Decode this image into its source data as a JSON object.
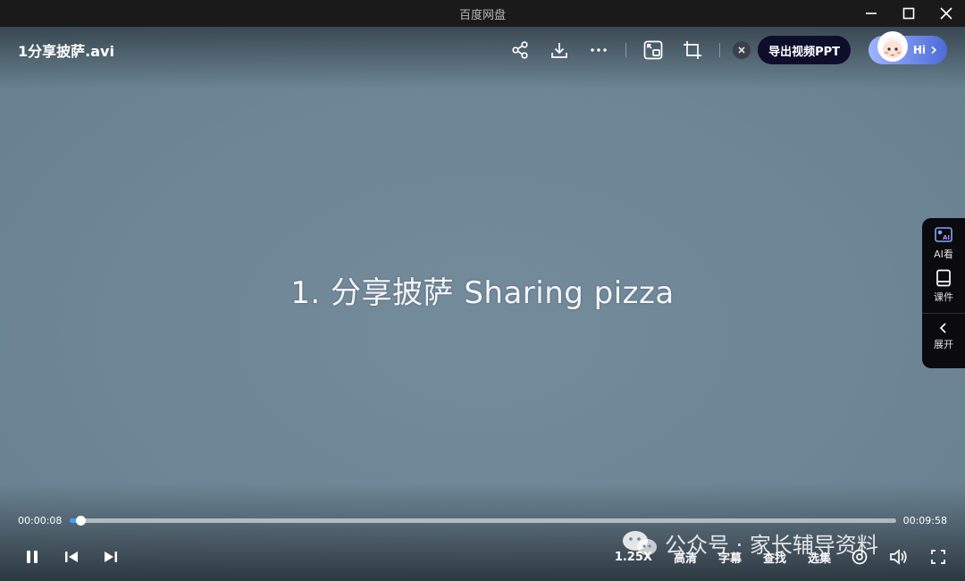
{
  "window": {
    "title": "百度网盘"
  },
  "player": {
    "file_name": "1分享披萨.avi",
    "caption": "1. 分享披萨  Sharing pizza",
    "export_ppt_label": "导出视频PPT",
    "hi_label": "Hi",
    "current_time": "00:00:08",
    "total_time": "00:09:58",
    "progress_fraction": 0.013,
    "accent_color": "#3aa0ff"
  },
  "side_panel": {
    "items": [
      {
        "label": "AI看",
        "icon": "ai-view-icon"
      },
      {
        "label": "课件",
        "icon": "courseware-icon"
      },
      {
        "label": "展开",
        "icon": "chevron-left-icon"
      }
    ]
  },
  "controls": {
    "speed": "1.25X",
    "quality": "高清",
    "subtitle": "字幕",
    "search": "查找",
    "episodes": "选集"
  },
  "watermark": {
    "text": "公众号 · 家长辅导资料"
  }
}
